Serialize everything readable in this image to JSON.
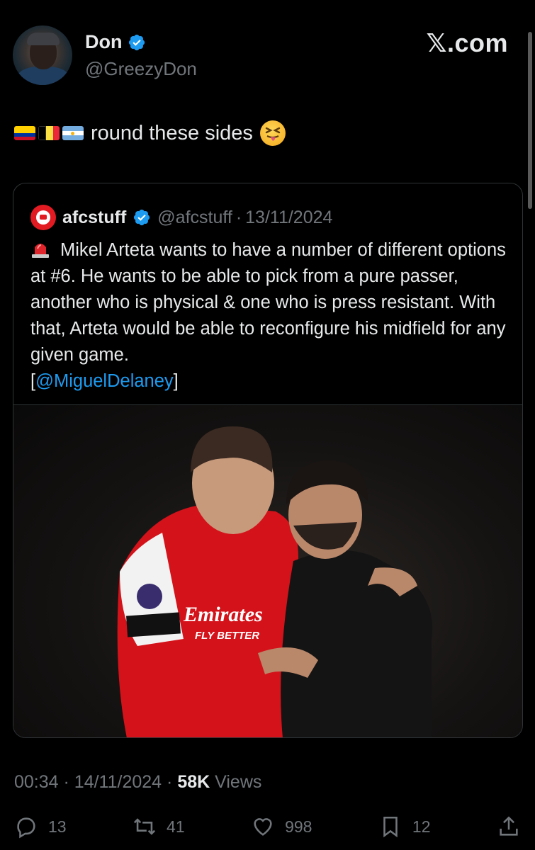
{
  "author": {
    "name": "Don",
    "handle": "@GreezyDon"
  },
  "brand": "𝕏.com",
  "tweet": {
    "text": "round these sides",
    "flags": [
      "ecuador-flag",
      "belgium-flag",
      "argentina-flag"
    ],
    "emoji": "squinting-face-with-tongue"
  },
  "quote": {
    "name": "afcstuff",
    "handle": "@afcstuff",
    "separator": "·",
    "date": "13/11/2024",
    "body": "Mikel Arteta wants to have a number of different options at #6. He wants to be able to pick from a pure passer, another who is physical & one who is press resistant. With that, Arteta would be able to reconfigure his midfield for any given game.",
    "bracket_open": "[",
    "mention": "@MiguelDelaney",
    "bracket_close": "]",
    "jersey_sponsor_line1": "Emirates",
    "jersey_sponsor_line2": "FLY BETTER"
  },
  "meta": {
    "time": "00:34",
    "separator": "·",
    "date": "14/11/2024",
    "views_count": "58K",
    "views_label": "Views"
  },
  "actions": {
    "replies": "13",
    "reposts": "41",
    "likes": "998",
    "bookmarks": "12"
  },
  "colors": {
    "background": "#000000",
    "link": "#1d9bf0",
    "verified": "#1d9bf0",
    "muted": "#71767b",
    "arsenal_red": "#e21b23"
  }
}
